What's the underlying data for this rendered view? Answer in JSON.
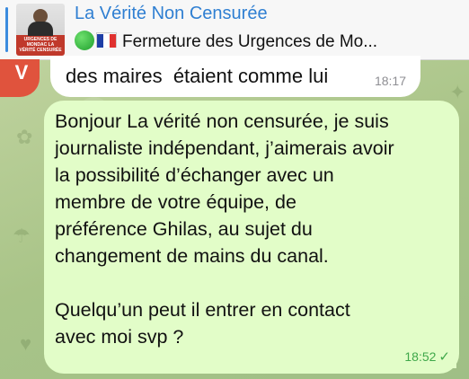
{
  "pinned": {
    "channel_name": "La Vérité Non Censurée",
    "preview_text": "Fermeture des Urgences de Mo...",
    "thumb_caption": "URGENCES DE MONDAC LA VÉRITÉ CENSURÉE"
  },
  "received": {
    "sender_initial": "V",
    "text": "des maires  étaient comme lui",
    "time": "18:17"
  },
  "sent": {
    "text": "Bonjour La vérité non censurée, je suis\njournaliste indépendant, j’aimerais avoir\nla possibilité d’échanger avec un\nmembre de votre équipe, de\npréférence Ghilas, au sujet du\nchangement de mains du canal.\n\nQuelqu’un peut il entrer en contact\navec moi svp ?",
    "time": "18:52",
    "status_icon": "single-check-icon"
  },
  "colors": {
    "accent": "#2f7fd2",
    "sent_bubble": "#e2fdc8",
    "avatar": "#e0533d",
    "time_sent": "#3fa84a"
  }
}
